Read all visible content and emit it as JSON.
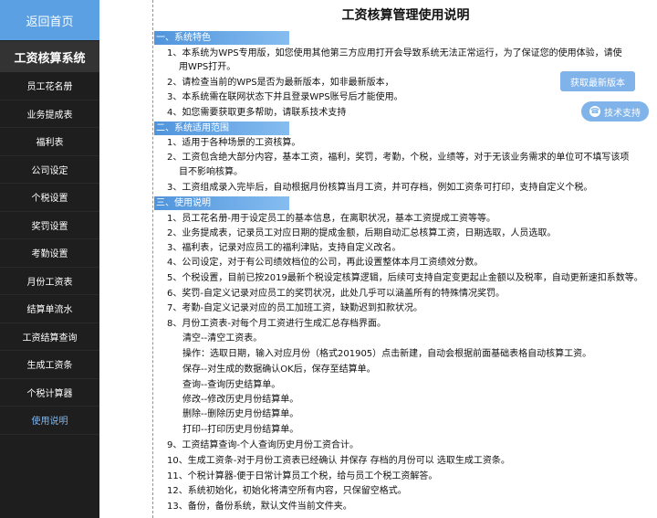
{
  "sidebar": {
    "home": "返回首页",
    "title": "工资核算系统",
    "items": [
      {
        "label": "员工花名册"
      },
      {
        "label": "业务提成表"
      },
      {
        "label": "福利表"
      },
      {
        "label": "公司设定"
      },
      {
        "label": "个税设置"
      },
      {
        "label": "奖罚设置"
      },
      {
        "label": "考勤设置"
      },
      {
        "label": "月份工资表"
      },
      {
        "label": "结算单流水"
      },
      {
        "label": "工资结算查询"
      },
      {
        "label": "生成工资条"
      },
      {
        "label": "个税计算器"
      },
      {
        "label": "使用说明",
        "active": true
      }
    ]
  },
  "main": {
    "title": "工资核算管理使用说明",
    "buttons": {
      "latest": "获取最新版本",
      "support": "技术支持"
    },
    "sections": [
      {
        "heading": "一、系统特色",
        "lines": [
          "1、本系统为WPS专用版，如您使用其他第三方应用打开会导致系统无法正常运行，为了保证您的使用体验，请使",
          "用WPS打开。",
          "2、请检查当前的WPS是否为最新版本，如非最新版本，",
          "3、本系统需在联网状态下并且登录WPS账号后才能使用。",
          "4、如您需要获取更多帮助，请联系技术支持"
        ]
      },
      {
        "heading": "二、系统适用范围",
        "lines": [
          "1、适用于各种场景的工资核算。",
          "2、工资包含绝大部分内容，基本工资，福利，奖罚，考勤，个税，业绩等，对于无该业务需求的单位可不填写该项",
          "目不影响核算。",
          "3、工资组成录入完毕后，自动根据月份核算当月工资，并可存档，例如工资条可打印，支持自定义个税。"
        ]
      },
      {
        "heading": "三、使用说明",
        "lines": [
          "1、员工花名册-用于设定员工的基本信息，在离职状况，基本工资提成工资等等。",
          "2、业务提成表，记录员工对应日期的提成金额，后期自动汇总核算工资，日期选取，人员选取。",
          "3、福利表，记录对应员工的福利津贴，支持自定义改名。",
          "4、公司设定，对于有公司绩效档位的公司，再此设置整体本月工资绩效分数。",
          "5、个税设置，目前已按2019最新个税设定核算逻辑，后续可支持自定变更起止金额以及税率，自动更新速扣系数等。",
          "6、奖罚-自定义记录对应员工的奖罚状况，此处几乎可以涵盖所有的特殊情况奖罚。",
          "7、考勤-自定义记录对应的员工加班工资，缺勤迟到扣款状况。",
          "8、月份工资表-对每个月工资进行生成汇总存档界面。",
          "清空--清空工资表。",
          "操作：选取日期，输入对应月份（格式201905）点击新建，自动会根据前面基础表格自动核算工资。",
          "保存--对生成的数据确认OK后，保存至结算单。",
          "查询--查询历史结算单。",
          "修改--修改历史月份结算单。",
          "删除--删除历史月份结算单。",
          "打印--打印历史月份结算单。",
          "9、工资结算查询-个人查询历史月份工资合计。",
          "10、生成工资条-对于月份工资表已经确认 并保存 存档的月份可以 选取生成工资条。",
          "11、个税计算器-便于日常计算员工个税，给与员工个税工资解答。",
          "12、系统初始化，初始化将清空所有内容，只保留空格式。",
          "13、备份，备份系统，默认文件当前文件夹。"
        ]
      }
    ]
  }
}
